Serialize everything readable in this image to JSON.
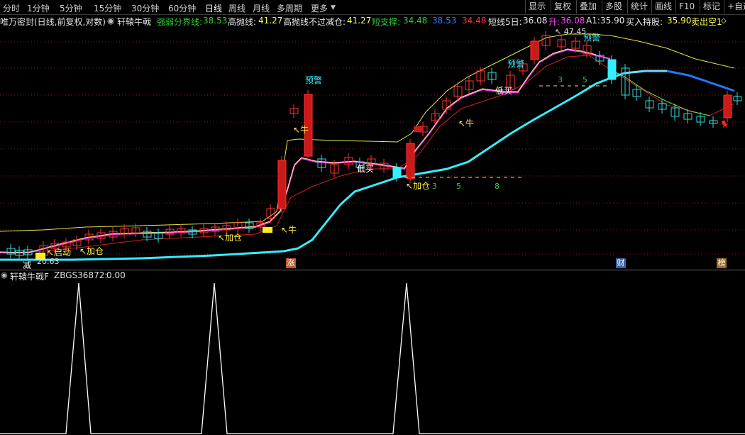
{
  "toolbar": {
    "periods": [
      "分时",
      "1分钟",
      "5分钟",
      "15分钟",
      "30分钟",
      "60分钟",
      "日线",
      "周线",
      "月线",
      "多周期",
      "更多"
    ],
    "active_period": "日线",
    "right_buttons": [
      "显示",
      "复权",
      "叠加",
      "多股",
      "统计",
      "画线",
      "F10",
      "标记",
      "+自选"
    ]
  },
  "info_line": {
    "stock": "唯万密封(日线,前复权,对数)",
    "indicator": "轩辕牛戟",
    "items": [
      {
        "label": "强弱分界线:",
        "value": "38.53",
        "color": "#33cc33"
      },
      {
        "label": "高抛线:",
        "value": "41.27",
        "color": "#ffff55"
      },
      {
        "label": "高抛线不过减仓:",
        "value": "41.27",
        "color": "#ffff55"
      },
      {
        "label": "短支撑:",
        "value": "34.48",
        "color": "#33cc33"
      },
      {
        "label": "",
        "value": "38.53",
        "color": "#3377ff"
      },
      {
        "label": "",
        "value": "34.48",
        "color": "#ff3333"
      },
      {
        "label": "短线5日:",
        "value": "36.08",
        "color": "#e0e0e0"
      },
      {
        "label": "升:",
        "value": "36.08",
        "color": "#ff44ff"
      },
      {
        "label": "A1:",
        "value": "35.90",
        "color": "#e0e0e0"
      },
      {
        "label": "买入持股:",
        "value": "35.90",
        "color": "#ffff55"
      },
      {
        "label": "卖出空1",
        "value": "",
        "color": "#ffff55"
      }
    ]
  },
  "annotations": {
    "sell_warning": "预警",
    "bull": "牛",
    "add_position": "加仓",
    "start": "启动",
    "low_buy": "低买",
    "reduce": "减",
    "high_price": "47.45",
    "low_price": "20.63",
    "count_3": "3",
    "count_5": "5",
    "count_8": "8"
  },
  "bottom_markers": {
    "zhang": "涨",
    "cai": "财",
    "bang": "榜"
  },
  "sub_panel": {
    "title": "轩辕牛戟F",
    "indicator_label": "ZBGS36872:",
    "indicator_value": "0.00"
  },
  "colors": {
    "up_candle": "#ff3333",
    "down_candle": "#33dddd",
    "support_line": "#33eeff",
    "upper_band": "#e6e64c",
    "ma_red": "#cc2222",
    "white_line": "#ffffff",
    "magenta_line": "#ff44ff",
    "blue_line": "#2277ff"
  }
}
